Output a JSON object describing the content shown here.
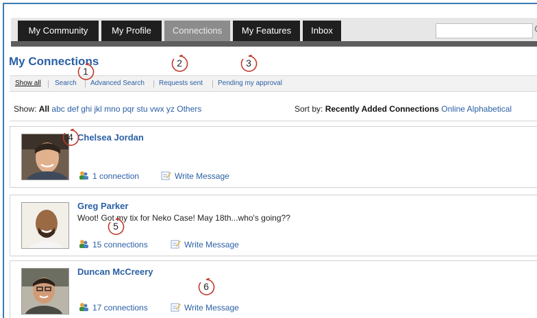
{
  "nav": {
    "tabs": [
      {
        "label": "My Community",
        "active": false
      },
      {
        "label": "My Profile",
        "active": false
      },
      {
        "label": "Connections",
        "active": true
      },
      {
        "label": "My Features",
        "active": false
      },
      {
        "label": "Inbox",
        "active": false
      }
    ],
    "search": {
      "value": "",
      "placeholder": ""
    }
  },
  "page_title": "My Connections",
  "subnav": {
    "items": [
      "Show all",
      "Search",
      "Advanced Search",
      "Requests sent",
      "Pending my approval"
    ]
  },
  "filter": {
    "label": "Show:",
    "all": "All",
    "letters": [
      "abc",
      "def",
      "ghi",
      "jkl",
      "mno",
      "pqr",
      "stu",
      "vwx",
      "yz",
      "Others"
    ]
  },
  "sort": {
    "label": "Sort by:",
    "current": "Recently Added Connections",
    "options": [
      "Online",
      "Alphabetical"
    ]
  },
  "connections": [
    {
      "name": "Chelsea Jordan",
      "status": "",
      "connections": "1 connection",
      "message": "Write Message"
    },
    {
      "name": "Greg Parker",
      "status": "Woot! Got my tix for Neko Case! May 18th...who's going??",
      "connections": "15 connections",
      "message": "Write Message"
    },
    {
      "name": "Duncan McCreery",
      "status": "",
      "connections": "17 connections",
      "message": "Write Message"
    }
  ],
  "annotations": [
    "1",
    "2",
    "3",
    "4",
    "5",
    "6"
  ],
  "colors": {
    "link": "#2a5fa5",
    "nav_dark": "#1f1f1f",
    "nav_active": "#8c8c8c",
    "annotation": "#c0392b",
    "frame": "#3a78b6"
  }
}
